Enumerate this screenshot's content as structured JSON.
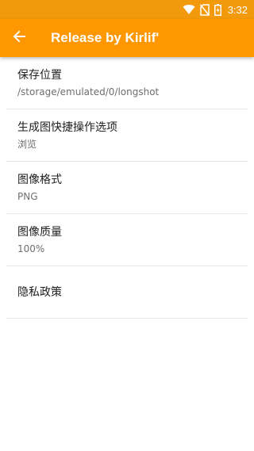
{
  "status_bar": {
    "time": "3:32",
    "icons": [
      "wifi-icon",
      "no-sim-icon",
      "battery-charging-icon"
    ]
  },
  "app_bar": {
    "back_icon": "arrow-left-icon",
    "title": "Release by Kirlif'"
  },
  "colors": {
    "status_bar": "#f39a0c",
    "app_bar": "#ff9800",
    "background": "#ffffff"
  },
  "settings": [
    {
      "title": "保存位置",
      "summary": "/storage/emulated/0/longshot"
    },
    {
      "title": "生成图快捷操作选项",
      "summary": "浏览"
    },
    {
      "title": "图像格式",
      "summary": "PNG"
    },
    {
      "title": "图像质量",
      "summary": "100%"
    },
    {
      "title": "隐私政策",
      "summary": ""
    }
  ]
}
